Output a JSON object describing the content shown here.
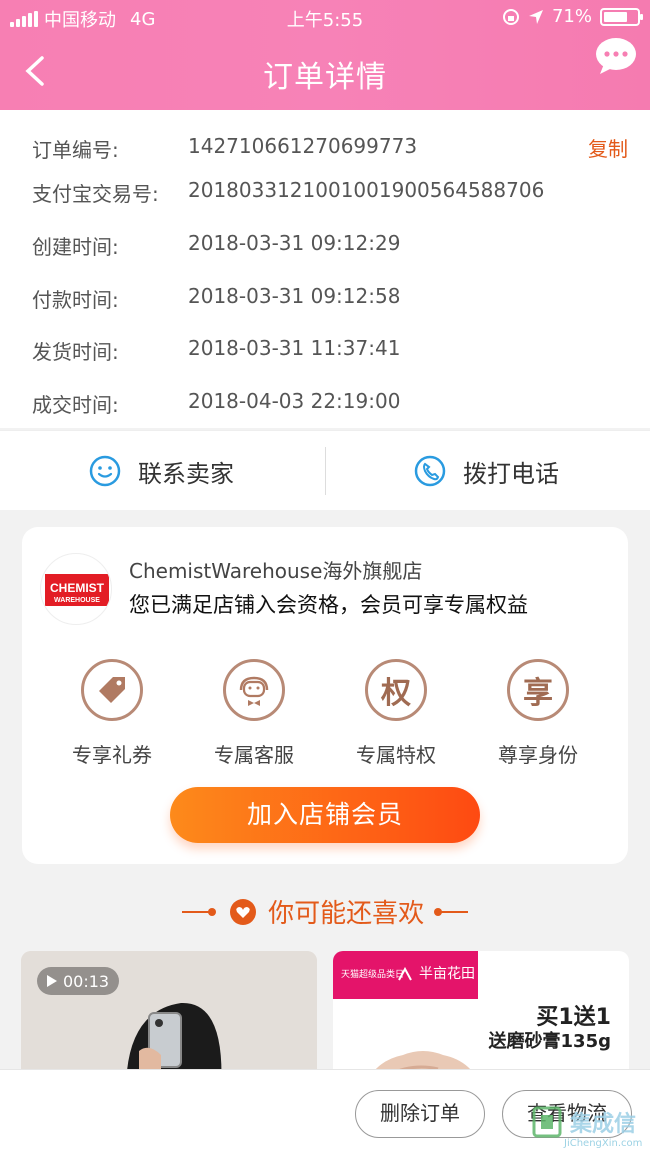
{
  "status_bar": {
    "carrier": "中国移动",
    "network": "4G",
    "time": "上午5:55",
    "battery": "71%",
    "battery_level": 0.71
  },
  "header": {
    "title": "订单详情"
  },
  "order_info": {
    "copy_label": "复制",
    "rows": [
      {
        "label": "订单编号:",
        "value": "142710661270699773"
      },
      {
        "label": "支付宝交易号:",
        "value": "2018033121001001900564588706"
      },
      {
        "label": "创建时间:",
        "value": "2018-03-31 09:12:29"
      },
      {
        "label": "付款时间:",
        "value": "2018-03-31 09:12:58"
      },
      {
        "label": "发货时间:",
        "value": "2018-03-31 11:37:41"
      },
      {
        "label": "成交时间:",
        "value": "2018-04-03 22:19:00"
      }
    ]
  },
  "contact": {
    "seller_label": "联系卖家",
    "call_label": "拨打电话"
  },
  "store": {
    "logo_text_1": "CHEMIST",
    "logo_text_2": "WAREHOUSE",
    "name": "ChemistWarehouse海外旗舰店",
    "tip": "您已满足店铺入会资格，会员可享专属权益",
    "perks": [
      {
        "label": "专享礼券",
        "icon": "coupon-tag-icon",
        "glyph": ""
      },
      {
        "label": "专属客服",
        "icon": "service-bowtie-icon",
        "glyph": ""
      },
      {
        "label": "专属特权",
        "icon": "privilege-icon",
        "glyph": "权"
      },
      {
        "label": "尊享身份",
        "icon": "identity-icon",
        "glyph": "享"
      }
    ],
    "join_label": "加入店铺会员"
  },
  "recommend": {
    "title": "你可能还喜欢",
    "video_duration": "00:13",
    "promo_brand_left": "天猫超级品类日",
    "promo_brand_right": "半亩花田",
    "promo_line1": "买1送1",
    "promo_line2": "送磨砂膏135g"
  },
  "bottom_bar": {
    "delete_label": "删除订单",
    "logistics_label": "查看物流"
  },
  "watermark": {
    "text": "集成信",
    "sub": "JiChengXin.com"
  },
  "colors": {
    "header_pink": "#f77fb3",
    "accent_orange": "#e35a1a",
    "join_gradient_start": "#fd8a1b",
    "join_gradient_end": "#fe4a12",
    "perk_brown": "#b88a76"
  }
}
